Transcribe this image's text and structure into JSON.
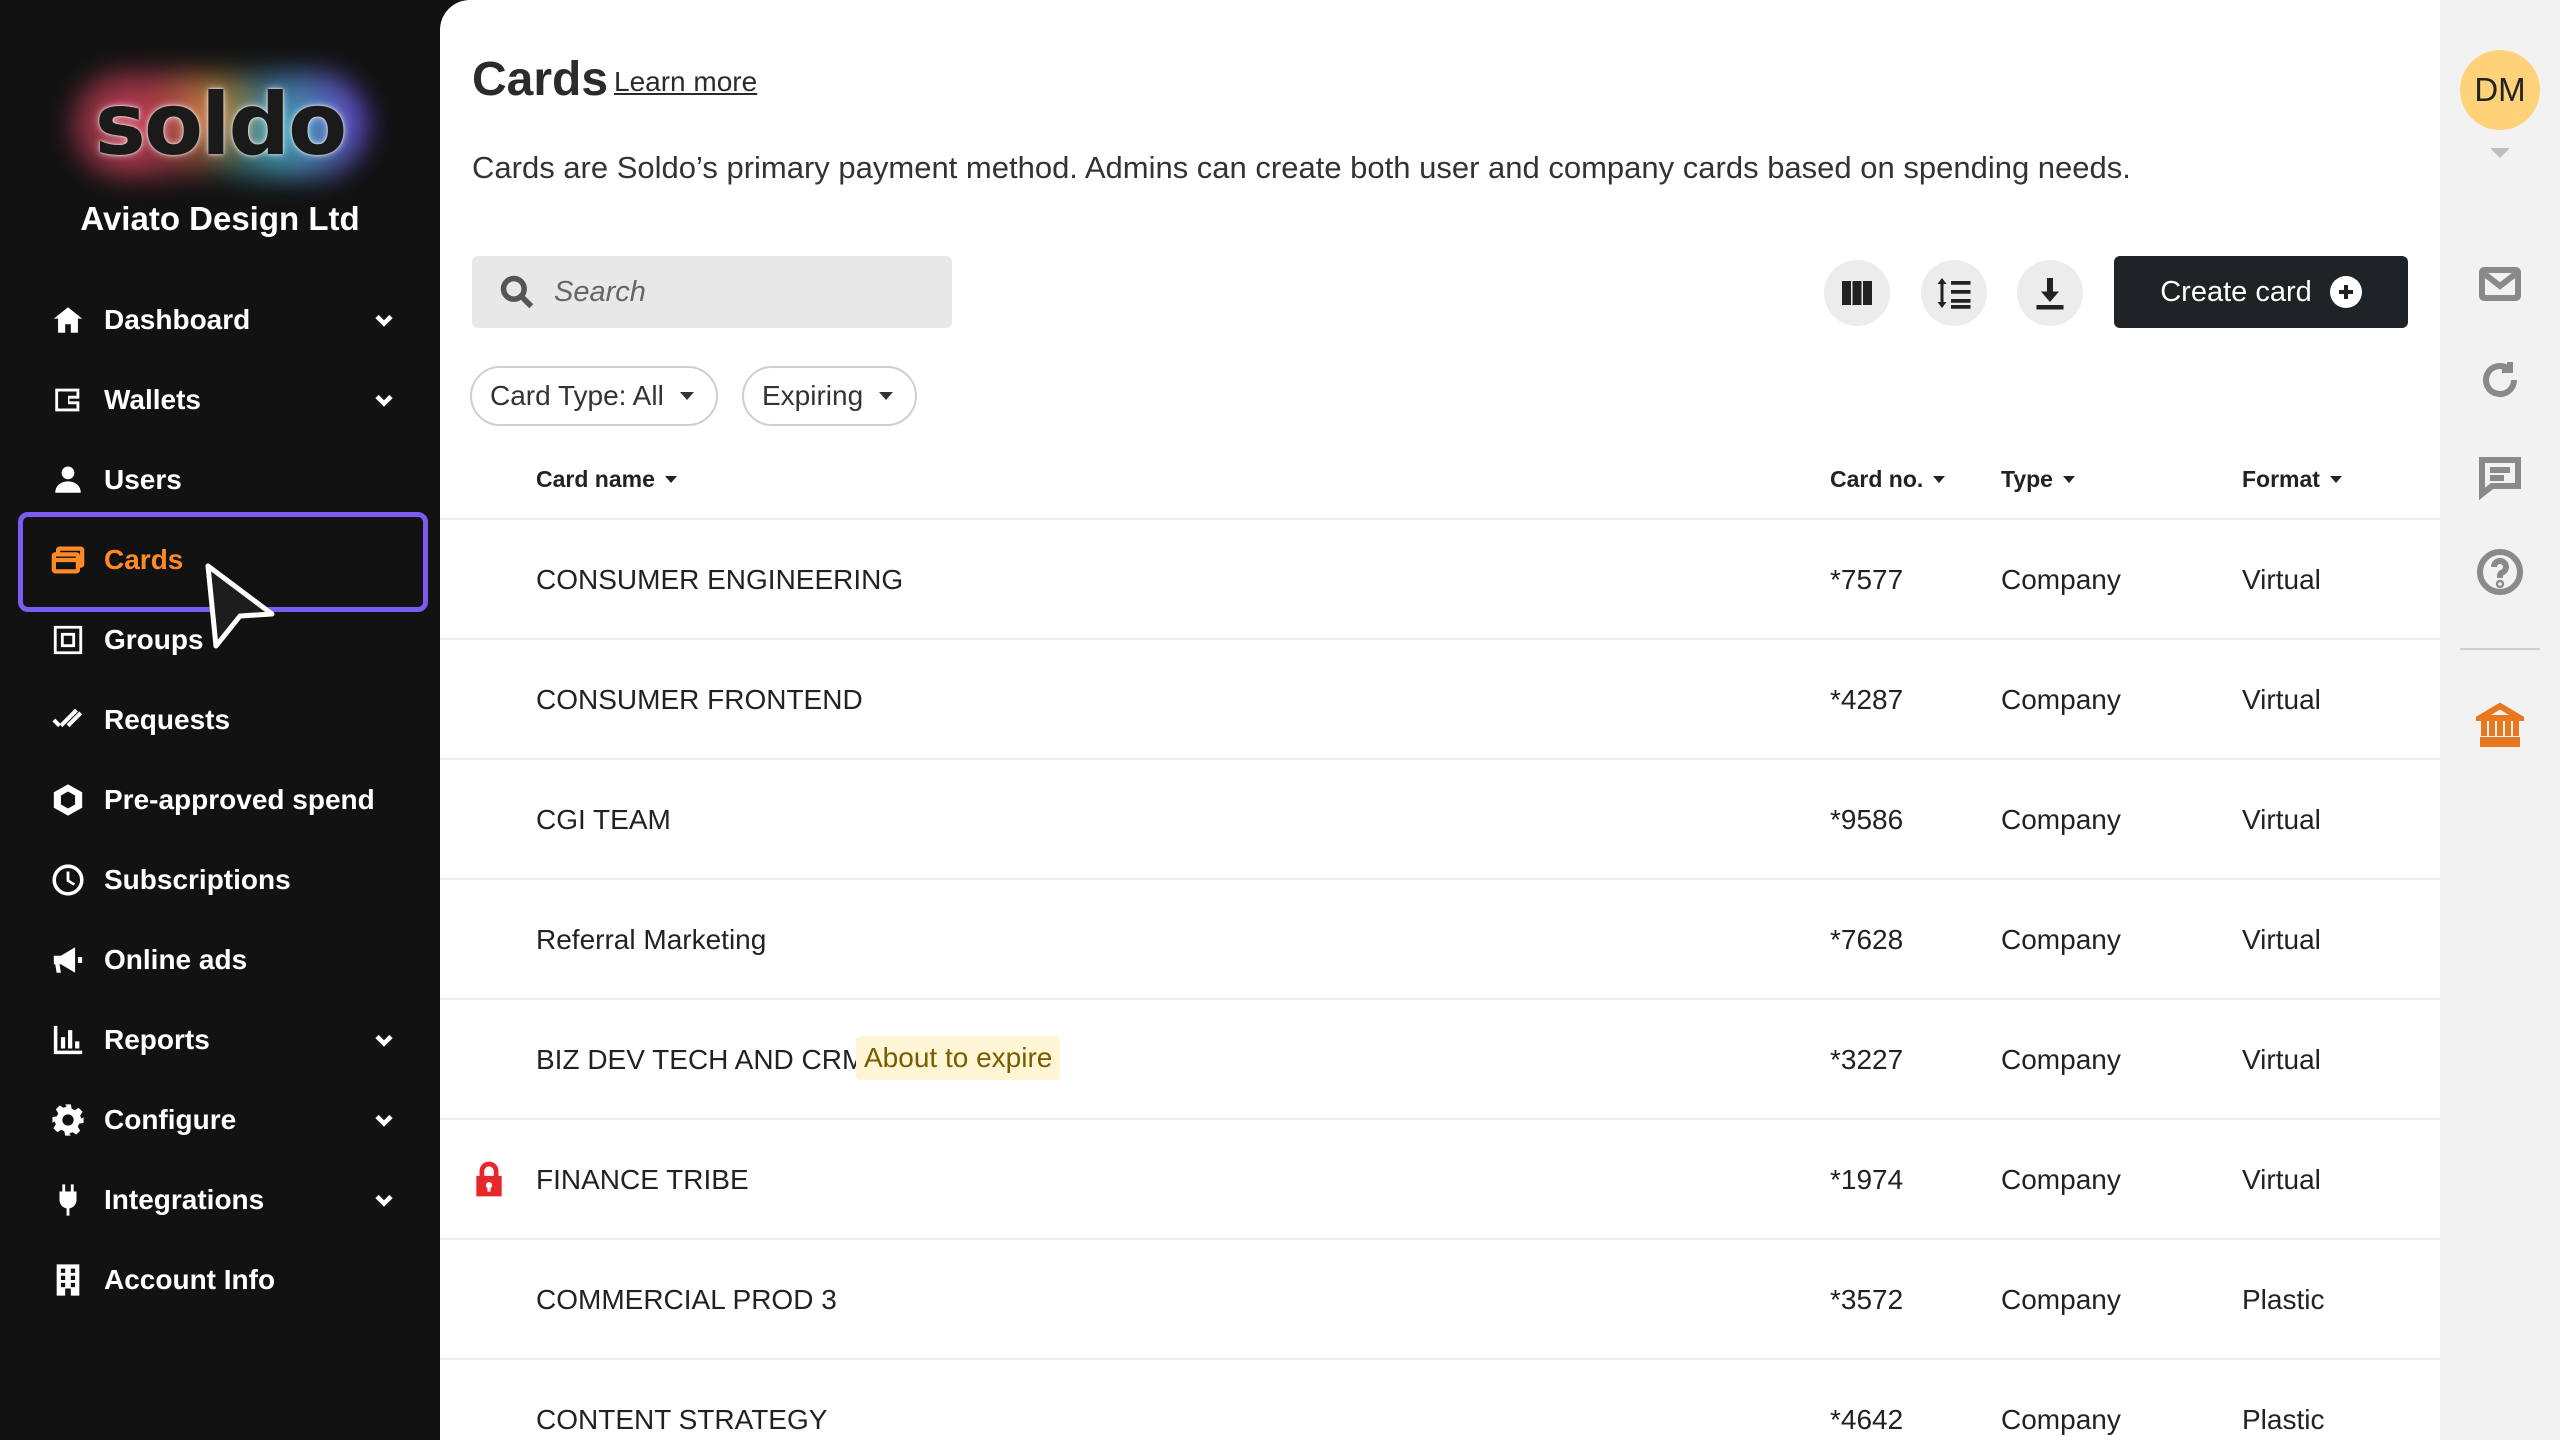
{
  "brand": {
    "logo_text": "soldo",
    "company_name": "Aviato Design Ltd",
    "accent_color": "#ff8a2a",
    "highlight_color": "#7b5cf0"
  },
  "sidebar": {
    "items": [
      {
        "label": "Dashboard",
        "icon": "home-icon",
        "has_chevron": true
      },
      {
        "label": "Wallets",
        "icon": "wallet-icon",
        "has_chevron": true
      },
      {
        "label": "Users",
        "icon": "user-icon",
        "has_chevron": false
      },
      {
        "label": "Cards",
        "icon": "cards-icon",
        "has_chevron": false,
        "active": true
      },
      {
        "label": "Groups",
        "icon": "groups-icon",
        "has_chevron": false
      },
      {
        "label": "Requests",
        "icon": "double-check-icon",
        "has_chevron": false
      },
      {
        "label": "Pre-approved spend",
        "icon": "hexagon-icon",
        "has_chevron": false
      },
      {
        "label": "Subscriptions",
        "icon": "clock-icon",
        "has_chevron": false
      },
      {
        "label": "Online ads",
        "icon": "megaphone-icon",
        "has_chevron": false
      },
      {
        "label": "Reports",
        "icon": "bar-chart-icon",
        "has_chevron": true
      },
      {
        "label": "Configure",
        "icon": "gear-icon",
        "has_chevron": true
      },
      {
        "label": "Integrations",
        "icon": "plug-icon",
        "has_chevron": true
      },
      {
        "label": "Account Info",
        "icon": "building-icon",
        "has_chevron": false
      }
    ]
  },
  "header": {
    "title": "Cards",
    "learn_more": "Learn more",
    "description": "Cards are Soldo’s primary payment method. Admins can create both user and company cards based on spending needs."
  },
  "toolbar": {
    "search_placeholder": "Search",
    "create_label": "Create card",
    "icons": [
      "columns-icon",
      "row-density-icon",
      "download-icon"
    ]
  },
  "filters": [
    {
      "label": "Card Type: All"
    },
    {
      "label": "Expiring"
    }
  ],
  "table": {
    "columns": [
      "Card name",
      "Card no.",
      "Type",
      "Format"
    ],
    "rows": [
      {
        "name": "CONSUMER ENGINEERING",
        "number": "*7577",
        "type": "Company",
        "format": "Virtual",
        "badge": "",
        "locked": false
      },
      {
        "name": "CONSUMER FRONTEND",
        "number": "*4287",
        "type": "Company",
        "format": "Virtual",
        "badge": "",
        "locked": false
      },
      {
        "name": "CGI TEAM",
        "number": "*9586",
        "type": "Company",
        "format": "Virtual",
        "badge": "",
        "locked": false
      },
      {
        "name": "Referral Marketing",
        "number": "*7628",
        "type": "Company",
        "format": "Virtual",
        "badge": "",
        "locked": false
      },
      {
        "name": "BIZ DEV TECH AND CRM",
        "number": "*3227",
        "type": "Company",
        "format": "Virtual",
        "badge": "About to expire",
        "locked": false
      },
      {
        "name": "FINANCE TRIBE",
        "number": "*1974",
        "type": "Company",
        "format": "Virtual",
        "badge": "",
        "locked": true
      },
      {
        "name": "COMMERCIAL PROD 3",
        "number": "*3572",
        "type": "Company",
        "format": "Plastic",
        "badge": "",
        "locked": false
      },
      {
        "name": "CONTENT STRATEGY",
        "number": "*4642",
        "type": "Company",
        "format": "Plastic",
        "badge": "",
        "locked": false
      }
    ]
  },
  "rail": {
    "avatar_initials": "DM",
    "icons": [
      "mail-icon",
      "refresh-icon",
      "chat-icon",
      "help-icon",
      "bank-icon"
    ]
  }
}
